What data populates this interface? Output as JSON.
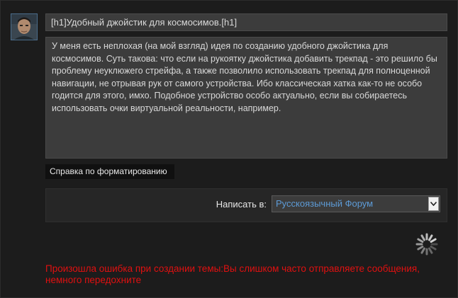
{
  "composer": {
    "title_value": "[h1]Удобный джойстик для космосимов.[h1]",
    "body_value": "  У меня есть неплохая (на мой взгляд) идея по созданию удобного джойстика для космосимов. Суть такова: что если на рукоятку джойстика добавить трекпад - это решило бы проблему неуклюжего стрейфа, а также позволило использовать трекпад для полноценной навигации, не отрывая рук от самого устройства. Ибо классическая хатка как-то не особо годится для этого, имхо. Подобное устройство особо актуально, если вы собираетесь использовать очки виртуальной реальности, например.",
    "format_help_label": "Справка по форматированию"
  },
  "post_to": {
    "label": "Написать в:",
    "selected_forum": "Русскоязычный Форум"
  },
  "status": {
    "error_message": "Произошла ошибка при создании темы:Вы слишком часто отправляете сообщения, немного передохните"
  },
  "icons": {
    "avatar": "user-avatar",
    "dropdown": "chevron-down-icon",
    "spinner": "loading-spinner-icon"
  },
  "colors": {
    "background": "#1c1c1c",
    "input_bg": "#3c3c3c",
    "link_blue": "#5d9bd6",
    "error_red": "#e01010"
  }
}
